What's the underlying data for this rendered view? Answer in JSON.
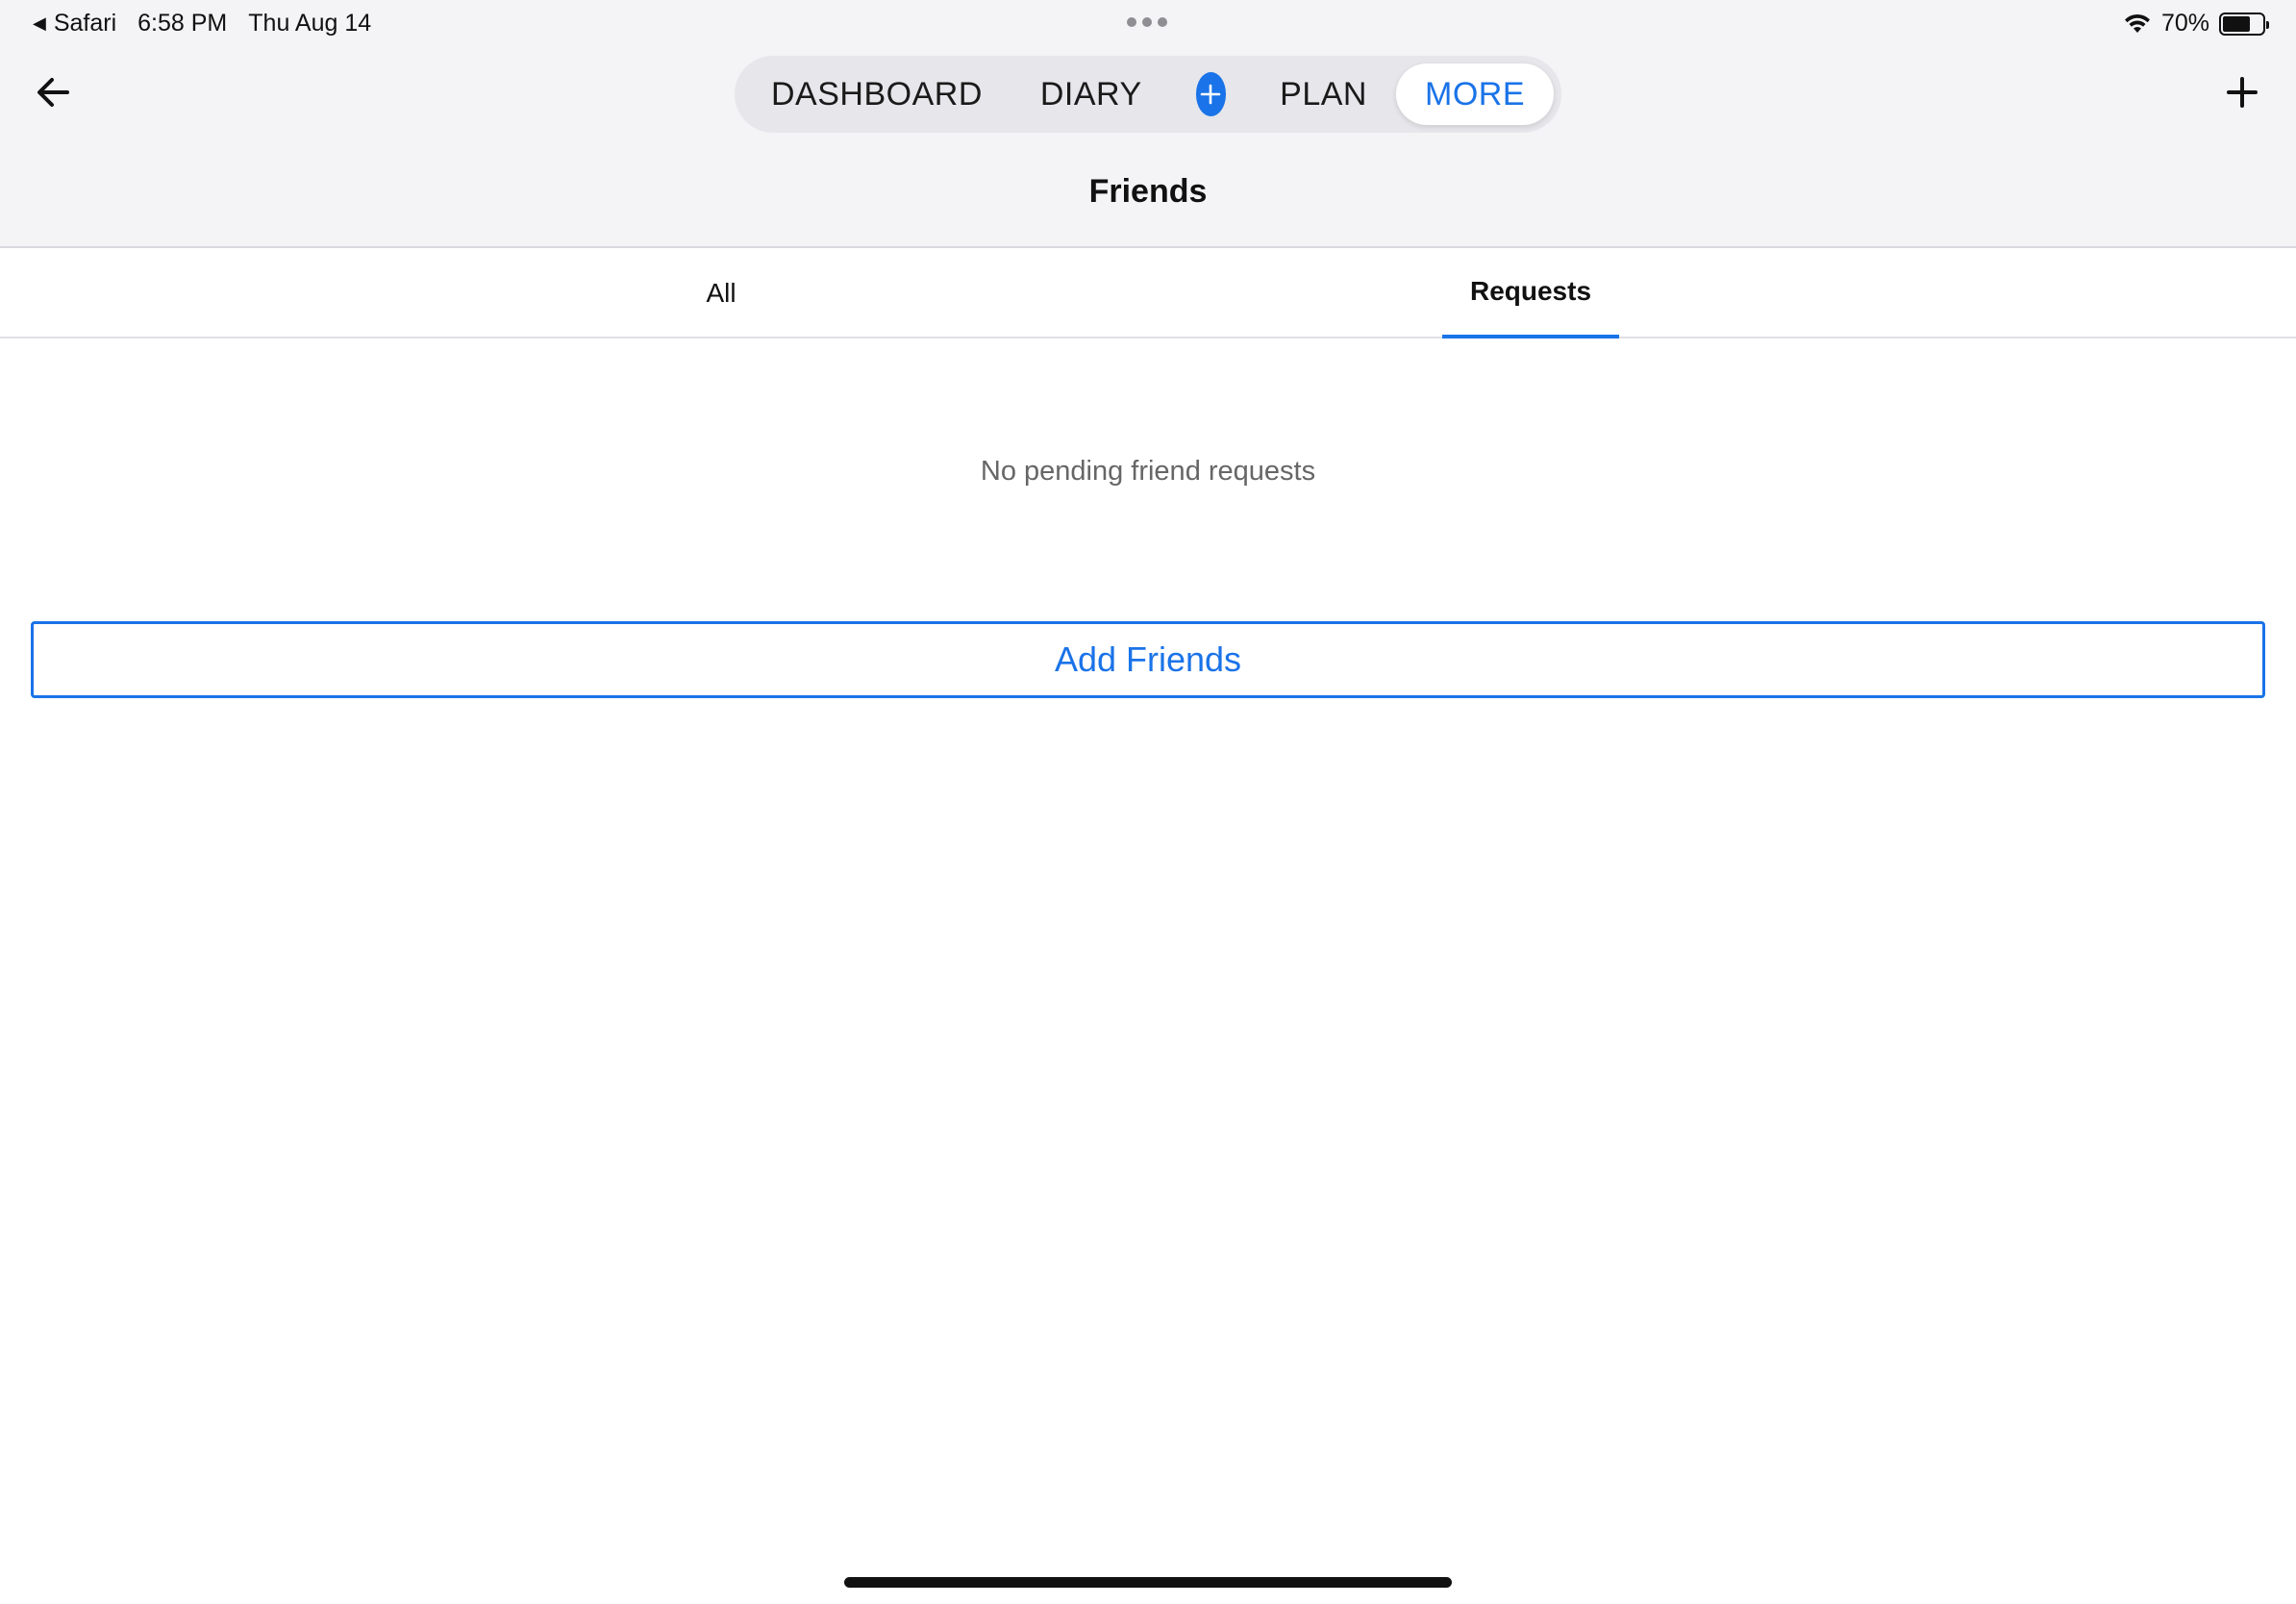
{
  "status_bar": {
    "back_app": "Safari",
    "time": "6:58 PM",
    "date": "Thu Aug 14",
    "battery": "70%",
    "battery_level": 0.7
  },
  "nav": {
    "items": [
      {
        "label": "DASHBOARD"
      },
      {
        "label": "DIARY"
      },
      {
        "label": "PLAN"
      },
      {
        "label": "MORE",
        "active": true
      }
    ],
    "accent_color": "#1a73e8"
  },
  "page": {
    "title": "Friends"
  },
  "tabs": [
    {
      "label": "All"
    },
    {
      "label": "Requests",
      "active": true
    }
  ],
  "content": {
    "empty_message": "No pending friend requests",
    "add_friends_label": "Add Friends"
  },
  "icons": {
    "back": "arrow-left-icon",
    "add": "plus-icon",
    "wifi": "wifi-icon",
    "battery": "battery-icon"
  }
}
